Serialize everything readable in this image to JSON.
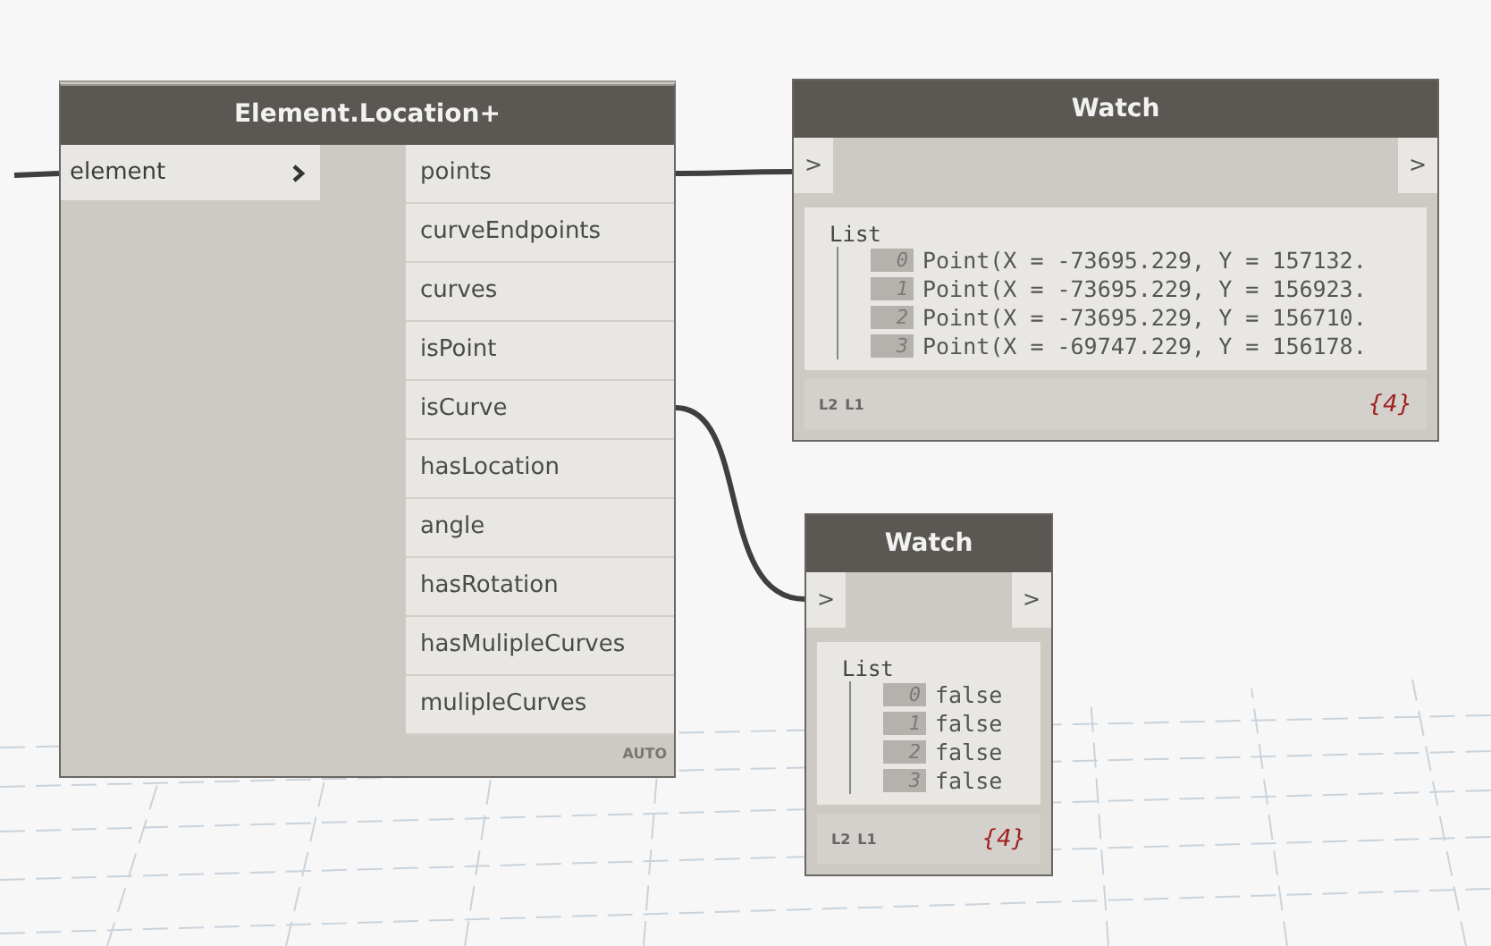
{
  "nodes": [
    {
      "kind": "function",
      "title": "Element.Location+",
      "inputs": [
        "element"
      ],
      "outputs": [
        "points",
        "curveEndpoints",
        "curves",
        "isPoint",
        "isCurve",
        "hasLocation",
        "angle",
        "hasRotation",
        "hasMulipleCurves",
        "mulipleCurves"
      ],
      "lacing": "AUTO"
    },
    {
      "kind": "watch",
      "title": "Watch",
      "ports": [
        ">",
        ">"
      ],
      "list_label": "List",
      "items": [
        {
          "index": "0",
          "value": "Point(X = -73695.229, Y = 157132."
        },
        {
          "index": "1",
          "value": "Point(X = -73695.229, Y = 156923."
        },
        {
          "index": "2",
          "value": "Point(X = -73695.229, Y = 156710."
        },
        {
          "index": "3",
          "value": "Point(X = -69747.229, Y = 156178."
        }
      ],
      "levels": [
        "L2",
        "L1"
      ],
      "count": "{4}"
    },
    {
      "kind": "watch",
      "title": "Watch",
      "ports": [
        ">",
        ">"
      ],
      "list_label": "List",
      "items": [
        {
          "index": "0",
          "value": "false"
        },
        {
          "index": "1",
          "value": "false"
        },
        {
          "index": "2",
          "value": "false"
        },
        {
          "index": "3",
          "value": "false"
        }
      ],
      "levels": [
        "L2",
        "L1"
      ],
      "count": "{4}"
    }
  ]
}
